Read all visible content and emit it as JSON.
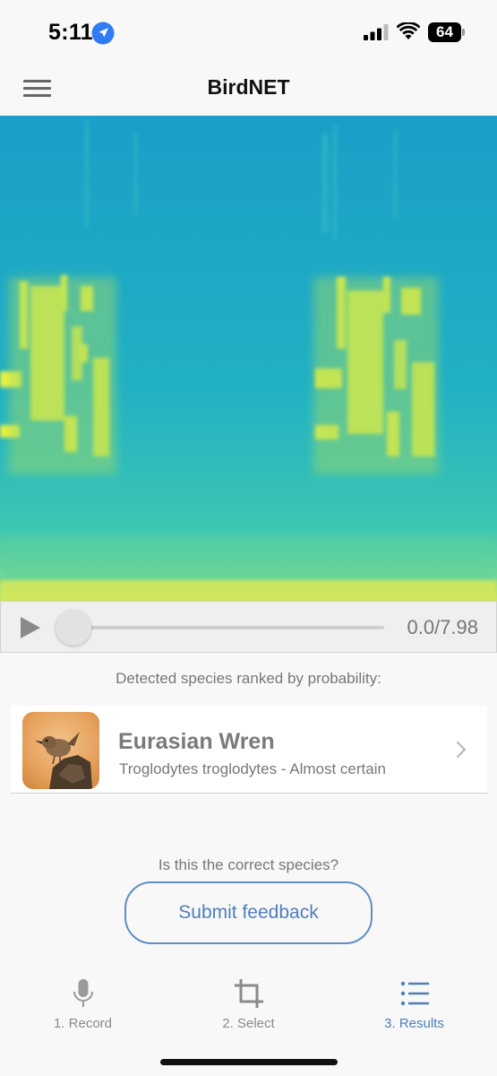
{
  "status_bar": {
    "time": "5:11",
    "battery": "64",
    "icons": [
      "location-arrow-icon",
      "cellular-signal-icon",
      "wifi-icon",
      "battery-icon"
    ]
  },
  "header": {
    "title": "BirdNET",
    "menu_icon": "hamburger-menu-icon"
  },
  "player": {
    "time_readout": "0.0/7.98",
    "progress": 0,
    "play_icon": "play-icon"
  },
  "results": {
    "heading": "Detected species ranked by probability:",
    "items": [
      {
        "common_name": "Eurasian Wren",
        "detail": "Troglodytes troglodytes - Almost certain"
      }
    ]
  },
  "feedback": {
    "question": "Is this the correct species?",
    "button_label": "Submit feedback"
  },
  "tabs": [
    {
      "label": "1. Record",
      "icon": "microphone-icon",
      "active": false
    },
    {
      "label": "2. Select",
      "icon": "crop-icon",
      "active": false
    },
    {
      "label": "3. Results",
      "icon": "list-icon",
      "active": true
    }
  ],
  "colors": {
    "accent": "#4e7fb8",
    "spectrogram_background": "#1aa7c6",
    "spectrogram_highlight": "#f0f23a"
  }
}
